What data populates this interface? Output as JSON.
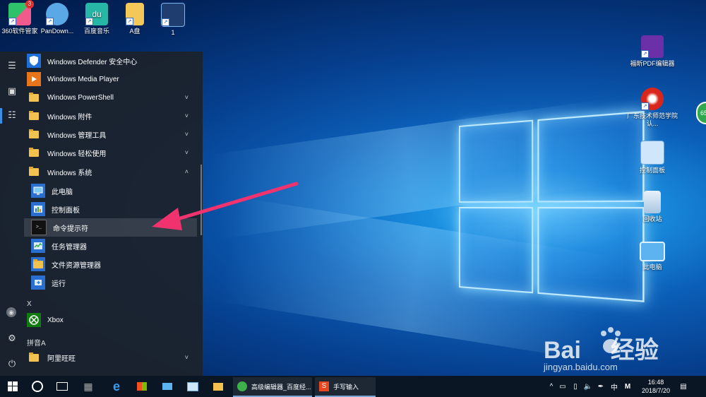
{
  "desktop_icons_top": [
    {
      "label": "360软件管家",
      "badge": "3"
    },
    {
      "label": "PanDown..."
    },
    {
      "label": "百度音乐"
    },
    {
      "label": "A盘"
    },
    {
      "label": "1"
    }
  ],
  "desktop_icons_right": [
    {
      "label": "福昕PDF编辑器"
    },
    {
      "label": "广东技术师范学院认..."
    },
    {
      "label": "控制面板"
    },
    {
      "label": "回收站"
    },
    {
      "label": "此电脑"
    }
  ],
  "side_badge": "65",
  "start_menu": {
    "items": [
      {
        "label": "Windows Defender 安全中心",
        "icon": "shield-icon"
      },
      {
        "label": "Windows Media Player",
        "icon": "media-player-icon"
      },
      {
        "label": "Windows PowerShell",
        "icon": "folder-icon",
        "chevron": "˅"
      },
      {
        "label": "Windows 附件",
        "icon": "folder-icon",
        "chevron": "˅"
      },
      {
        "label": "Windows 管理工具",
        "icon": "folder-icon",
        "chevron": "˅"
      },
      {
        "label": "Windows 轻松使用",
        "icon": "folder-icon",
        "chevron": "˅"
      },
      {
        "label": "Windows 系统",
        "icon": "folder-icon",
        "chevron": "˄"
      }
    ],
    "sub_items": [
      {
        "label": "此电脑",
        "icon": "computer-icon"
      },
      {
        "label": "控制面板",
        "icon": "control-panel-icon"
      },
      {
        "label": "命令提示符",
        "icon": "cmd-icon"
      },
      {
        "label": "任务管理器",
        "icon": "task-manager-icon"
      },
      {
        "label": "文件资源管理器",
        "icon": "folder-icon"
      },
      {
        "label": "运行",
        "icon": "run-icon"
      }
    ],
    "letter_x": "X",
    "xbox": {
      "label": "Xbox",
      "icon": "xbox-icon"
    },
    "letter_pinyin": "拼音A",
    "aliwangwang": {
      "label": "阿里旺旺",
      "icon": "folder-icon",
      "chevron": "˅"
    }
  },
  "taskbar": {
    "tasks": [
      {
        "label": "高级编辑器_百度经...",
        "icon": "browser-360-icon"
      },
      {
        "label": "手写输入",
        "icon": "sogou-icon"
      }
    ],
    "tray": {
      "ime": "中",
      "ime_mode": "M",
      "time": "16:48",
      "date": "2018/7/20"
    }
  },
  "watermark": {
    "brand": "Bai",
    "brand2": "经验",
    "url": "jingyan.baidu.com"
  },
  "colors": {
    "accent_arrow": "#f0336e",
    "taskbar": "#0b1624",
    "start_menu": "#1c222c",
    "desktop": "#0b5fb8"
  }
}
